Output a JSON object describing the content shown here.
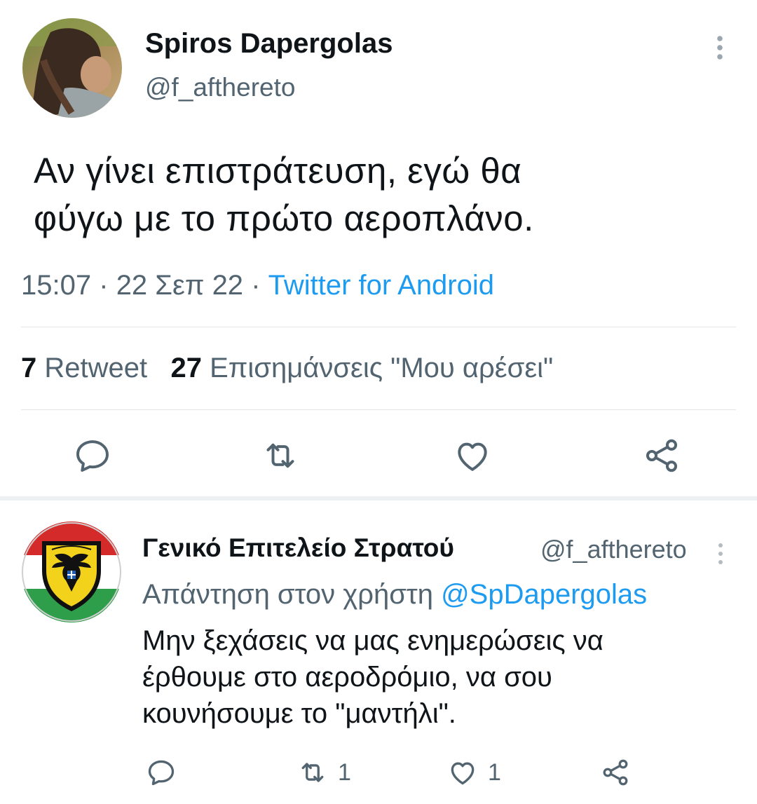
{
  "tweet": {
    "author": {
      "display_name": "Spiros Dapergolas",
      "handle": "@f_afthereto"
    },
    "text_lines": [
      "Αν γίνει επιστράτευση, εγώ θα",
      "φύγω με το πρώτο αεροπλάνο."
    ],
    "time": "15:07",
    "date": "22 Σεπ 22",
    "separator": "·",
    "source": "Twitter for Android",
    "stats": {
      "retweets_count": "7",
      "retweets_label": "Retweet",
      "likes_count": "27",
      "likes_label": "Επισημάνσεις \"Μου αρέσει\""
    },
    "actions": [
      {
        "name": "reply",
        "icon": "reply-icon"
      },
      {
        "name": "retweet",
        "icon": "retweet-icon"
      },
      {
        "name": "like",
        "icon": "heart-icon"
      },
      {
        "name": "share",
        "icon": "share-icon"
      }
    ]
  },
  "reply": {
    "author": {
      "display_name": "Γενικό Επιτελείο Στρατού",
      "handle": "@f_afthereto"
    },
    "replying_to_label": "Απάντηση στον χρήστη",
    "replying_to_mention": "@SpDapergolas",
    "text_lines": [
      "Μην ξεχάσεις να μας ενημερώσεις να",
      "έρθουμε στο αεροδρόμιο, να σου",
      "κουνήσουμε το \"μαντήλι\"."
    ],
    "counts": {
      "replies": "",
      "retweets": "1",
      "likes": "1"
    }
  },
  "colors": {
    "text_primary": "#0f1419",
    "text_secondary": "#536471",
    "accent": "#1d9bf0",
    "divider": "#e3e7ea"
  }
}
